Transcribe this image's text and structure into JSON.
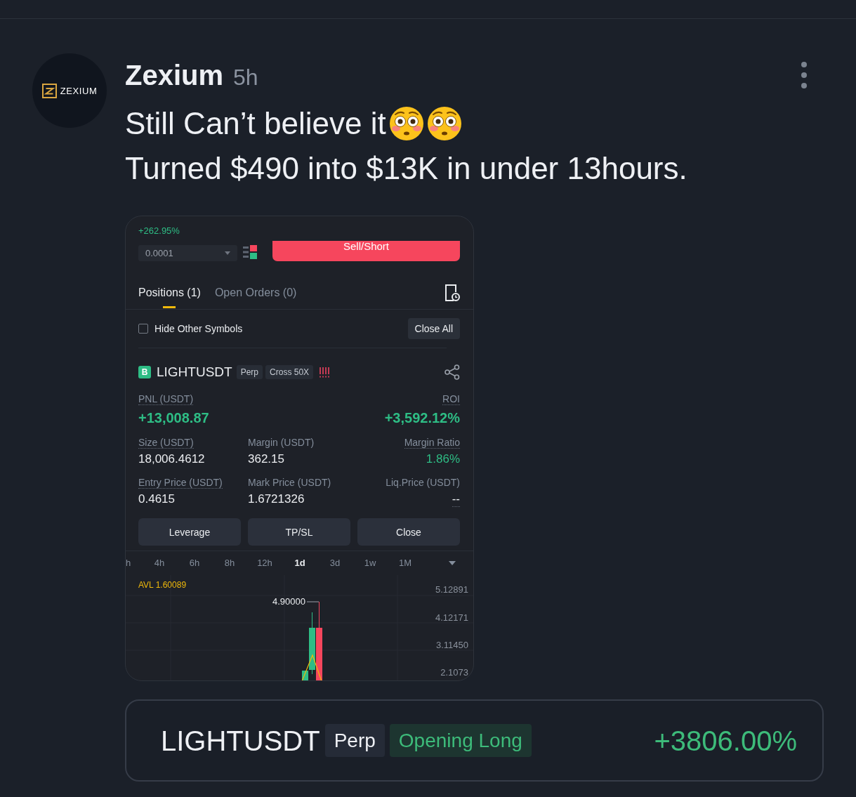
{
  "post": {
    "avatar": {
      "logo_text": "ZEXIUM"
    },
    "author": "Zexium",
    "time": "5h",
    "lines": [
      "Still Can’t believe it",
      "Turned $490 into $13K in under 13hours."
    ]
  },
  "screenshot": {
    "change": "+262.95%",
    "quantity_field": {
      "value": "0.0001"
    },
    "sell_button": "Sell/Short",
    "tabs": [
      {
        "label": "Positions (1)",
        "selected": true
      },
      {
        "label": "Open Orders (0)",
        "selected": false
      }
    ],
    "hide_other_symbols": {
      "label": "Hide Other Symbols",
      "checked": false
    },
    "close_all_button": "Close All",
    "position": {
      "side": "B",
      "symbol": "LIGHTUSDT",
      "tags": [
        "Perp",
        "Cross 50X"
      ],
      "metric_rows": [
        [
          {
            "label": "PNL (USDT)",
            "value": "+13,008.87",
            "label_dotted": true,
            "value_dotted": false,
            "color": "#2ebd85",
            "kind": "headline"
          },
          {
            "label": "ROI",
            "value": "+3,592.12%",
            "label_dotted": true,
            "value_dotted": false,
            "color": "#2ebd85",
            "kind": "headline"
          }
        ],
        [
          {
            "label": "Size (USDT)",
            "value": "18,006.4612",
            "label_dotted": true,
            "value_dotted": false,
            "color": "#eaecef",
            "kind": "regular"
          },
          {
            "label": "Margin (USDT)",
            "value": "362.15",
            "label_dotted": false,
            "value_dotted": false,
            "color": "#eaecef",
            "kind": "regular"
          },
          {
            "label": "Margin Ratio",
            "value": "1.86%",
            "label_dotted": true,
            "value_dotted": false,
            "color": "#2ebd85",
            "kind": "regular"
          }
        ],
        [
          {
            "label": "Entry Price (USDT)",
            "value": "0.4615",
            "label_dotted": true,
            "value_dotted": false,
            "color": "#eaecef",
            "kind": "regular"
          },
          {
            "label": "Mark Price (USDT)",
            "value": "1.6721326",
            "label_dotted": false,
            "value_dotted": false,
            "color": "#eaecef",
            "kind": "regular"
          },
          {
            "label": "Liq.Price (USDT)",
            "value": "--",
            "label_dotted": false,
            "value_dotted": true,
            "color": "#eaecef",
            "kind": "regular"
          }
        ]
      ],
      "buttons": [
        "Leverage",
        "TP/SL",
        "Close"
      ]
    },
    "intervals": [
      {
        "label": "h",
        "selected": false
      },
      {
        "label": "4h",
        "selected": false
      },
      {
        "label": "6h",
        "selected": false
      },
      {
        "label": "8h",
        "selected": false
      },
      {
        "label": "12h",
        "selected": false
      },
      {
        "label": "1d",
        "selected": true
      },
      {
        "label": "3d",
        "selected": false
      },
      {
        "label": "1w",
        "selected": false
      },
      {
        "label": "1M",
        "selected": false
      }
    ],
    "chart": {
      "indicator": "AVL 1.60089",
      "high_label": "4.90000",
      "price_labels": [
        "5.12891",
        "4.12171",
        "3.11450",
        "2.1073"
      ]
    }
  },
  "summary": {
    "symbol": "LIGHTUSDT",
    "tags": [
      {
        "label": "Perp",
        "kind": "market"
      },
      {
        "label": "Opening Long",
        "kind": "side"
      }
    ],
    "change": "+3806.00%"
  }
}
